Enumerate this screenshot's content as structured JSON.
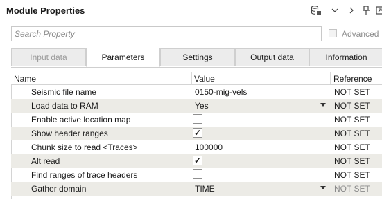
{
  "window": {
    "title": "Module Properties"
  },
  "search": {
    "placeholder": "Search Property",
    "value": ""
  },
  "advanced": {
    "label": "Advanced",
    "checked": false
  },
  "tabs": [
    {
      "label": "Input data",
      "state": "disabled"
    },
    {
      "label": "Parameters",
      "state": "active"
    },
    {
      "label": "Settings",
      "state": "normal"
    },
    {
      "label": "Output data",
      "state": "normal"
    },
    {
      "label": "Information",
      "state": "normal"
    }
  ],
  "grid": {
    "headers": {
      "name": "Name",
      "value": "Value",
      "reference": "Reference"
    },
    "rows": [
      {
        "name": "Seismic file name",
        "value": "0150-mig-vels",
        "type": "text",
        "reference": "NOT SET"
      },
      {
        "name": "Load data to RAM",
        "value": "Yes",
        "type": "dropdown",
        "reference": "NOT SET"
      },
      {
        "name": "Enable active location map",
        "value": "",
        "type": "checkbox",
        "checked": false,
        "reference": "NOT SET"
      },
      {
        "name": "Show header ranges",
        "value": "",
        "type": "checkbox",
        "checked": true,
        "reference": "NOT SET"
      },
      {
        "name": "Chunk size to read <Traces>",
        "value": "100000",
        "type": "text",
        "reference": "NOT SET"
      },
      {
        "name": "Alt read",
        "value": "",
        "type": "checkbox",
        "checked": true,
        "reference": "NOT SET"
      },
      {
        "name": "Find ranges of trace headers",
        "value": "",
        "type": "checkbox",
        "checked": false,
        "reference": "NOT SET"
      },
      {
        "name": "Gather domain",
        "value": "TIME",
        "type": "dropdown",
        "reference": "NOT SET",
        "reference_muted": true
      }
    ]
  },
  "check_mark": "✓"
}
